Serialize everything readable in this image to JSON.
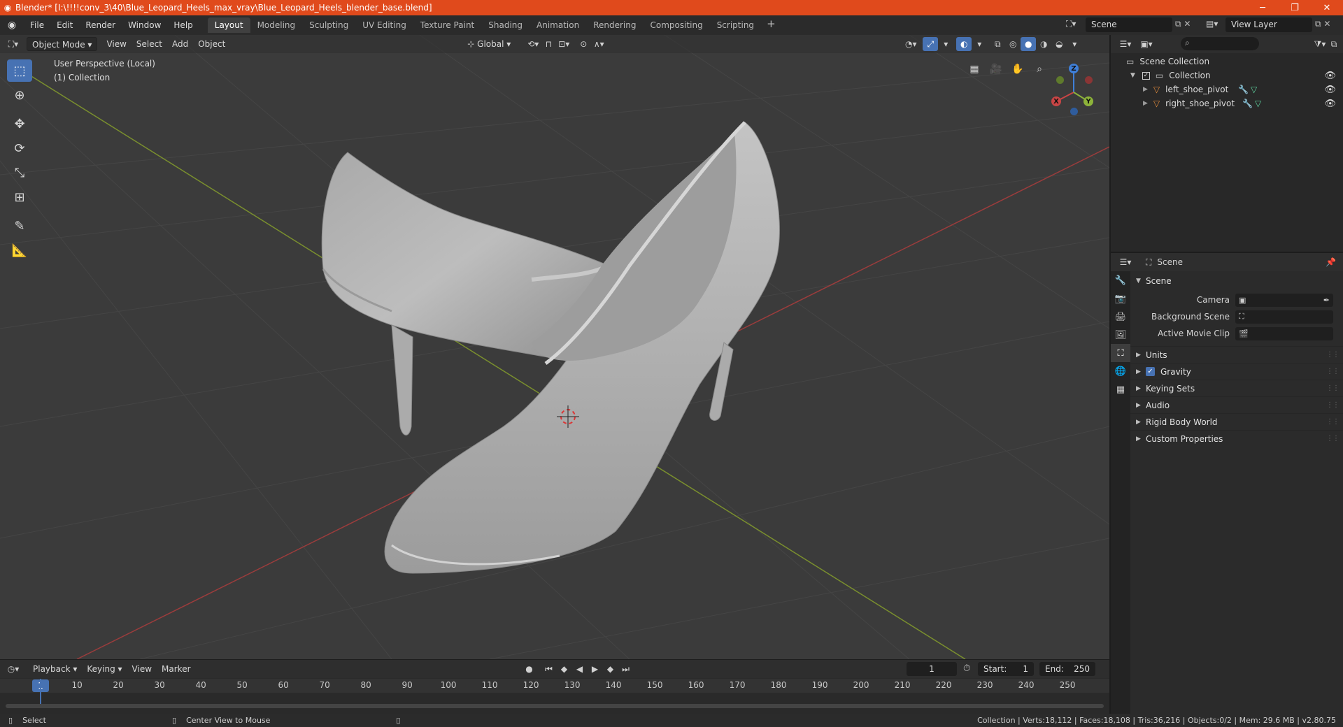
{
  "window": {
    "title": "Blender* [I:\\!!!!conv_3\\40\\Blue_Leopard_Heels_max_vray\\Blue_Leopard_Heels_blender_base.blend]",
    "min": "─",
    "max": "❐",
    "close": "✕"
  },
  "menu": [
    "File",
    "Edit",
    "Render",
    "Window",
    "Help"
  ],
  "workspaces": [
    "Layout",
    "Modeling",
    "Sculpting",
    "UV Editing",
    "Texture Paint",
    "Shading",
    "Animation",
    "Rendering",
    "Compositing",
    "Scripting"
  ],
  "active_workspace": "Layout",
  "scene_name": "Scene",
  "view_layer": "View Layer",
  "viewport": {
    "mode": "Object Mode",
    "menus": [
      "View",
      "Select",
      "Add",
      "Object"
    ],
    "transform_orientation": "Global",
    "perspective_label": "User Perspective (Local)",
    "collection_label": "(1) Collection",
    "gizmo": {
      "x": "X",
      "y": "Y",
      "z": "Z"
    }
  },
  "timeline": {
    "menus": [
      "Playback",
      "Keying",
      "View",
      "Marker"
    ],
    "current_frame": "1",
    "start_label": "Start:",
    "start": "1",
    "end_label": "End:",
    "end": "250",
    "ticks": [
      "10",
      "20",
      "30",
      "40",
      "50",
      "60",
      "70",
      "80",
      "90",
      "100",
      "110",
      "120",
      "130",
      "140",
      "150",
      "160",
      "170",
      "180",
      "190",
      "200",
      "210",
      "220",
      "230",
      "240",
      "250"
    ],
    "frame_badge": "1"
  },
  "status": {
    "left_action": "Select",
    "middle_action": "Center View to Mouse",
    "stats": "Collection | Verts:18,112 | Faces:18,108 | Tris:36,216 | Objects:0/2 | Mem: 29.6 MB | v2.80.75"
  },
  "outliner": {
    "root": "Scene Collection",
    "collection": "Collection",
    "objects": [
      "left_shoe_pivot",
      "right_shoe_pivot"
    ]
  },
  "properties": {
    "context": "Scene",
    "panel": "Scene",
    "fields": [
      {
        "label": "Camera",
        "value": ""
      },
      {
        "label": "Background Scene",
        "value": ""
      },
      {
        "label": "Active Movie Clip",
        "value": ""
      }
    ],
    "subpanels": [
      "Units",
      "Gravity",
      "Keying Sets",
      "Audio",
      "Rigid Body World",
      "Custom Properties"
    ]
  },
  "colors": {
    "accent": "#4772b3",
    "titlebar": "#e04a1c",
    "x_axis": "#c94545",
    "y_axis": "#8db33a",
    "z_axis": "#3f7fd8"
  }
}
